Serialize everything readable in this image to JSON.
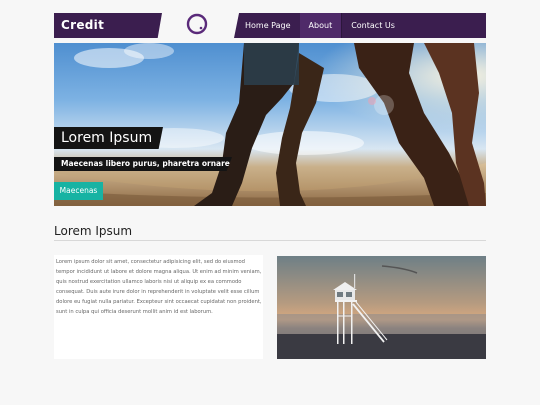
{
  "brand": {
    "name": "Credit"
  },
  "logo": {
    "icon": "circle-logo-icon",
    "color": "#5a2a7a"
  },
  "nav": {
    "items": [
      {
        "label": "Home Page"
      },
      {
        "label": "About"
      },
      {
        "label": "Contact Us"
      }
    ],
    "active_index": 1
  },
  "hero": {
    "title": "Lorem Ipsum",
    "subtitle": "Maecenas libero purus, pharetra ornare",
    "button_label": "Maecenas",
    "button_color": "#17b3a3"
  },
  "section": {
    "heading": "Lorem Ipsum",
    "body": "Lorem ipsum dolor sit amet, consectetur adipisicing elit, sed do eiusmod tempor incididunt ut labore et dolore magna aliqua. Ut enim ad minim veniam, quis nostrud exercitation ullamco laboris nisi ut aliquip ex ea commodo consequat. Duis aute irure dolor in reprehenderit in voluptate velit esse cillum dolore eu fugiat nulla pariatur. Excepteur sint occaecat cupidatat non proident, sunt in culpa qui officia deserunt mollit anim id est laborum."
  },
  "colors": {
    "header_bg": "#3b1e4f",
    "nav_active": "#4f2a69",
    "page_bg": "#f7f7f7"
  }
}
